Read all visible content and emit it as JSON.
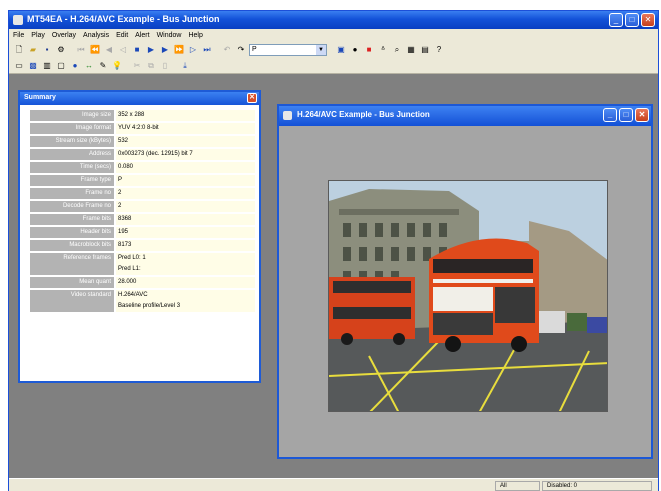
{
  "window": {
    "title": "MT54EA - H.264/AVC Example - Bus Junction"
  },
  "menu": [
    "File",
    "Play",
    "Overlay",
    "Analysis",
    "Edit",
    "Alert",
    "Window",
    "Help"
  ],
  "toolbar": {
    "combo_value": "P"
  },
  "summary": {
    "title": "Summary",
    "rows": [
      {
        "label": "Image size",
        "value": "352 x 288"
      },
      {
        "label": "Image format",
        "value": "YUV 4:2:0 8-bit"
      },
      {
        "label": "Stream size (kBytes)",
        "value": "532"
      },
      {
        "label": "Address",
        "value": "0x003273 (dec. 12915) bit 7"
      },
      {
        "label": "Time (secs)",
        "value": "0.080"
      },
      {
        "label": "Frame type",
        "value": "P"
      },
      {
        "label": "Frame no",
        "value": "2"
      },
      {
        "label": "Decode Frame no",
        "value": "2"
      },
      {
        "label": "Frame bits",
        "value": "8368"
      },
      {
        "label": "Header bits",
        "value": "195"
      },
      {
        "label": "Macroblock bits",
        "value": "8173"
      },
      {
        "label": "Reference frames",
        "value": "Pred L0: 1\nPred L1: "
      },
      {
        "label": "Mean quant",
        "value": "28.000"
      },
      {
        "label": "Video standard",
        "value": "H.264/AVC\nBaseline profile/Level 3"
      }
    ]
  },
  "video_window": {
    "title": "H.264/AVC Example - Bus Junction"
  },
  "status": {
    "cell1": "All",
    "cell2": "Disabled: 0"
  }
}
